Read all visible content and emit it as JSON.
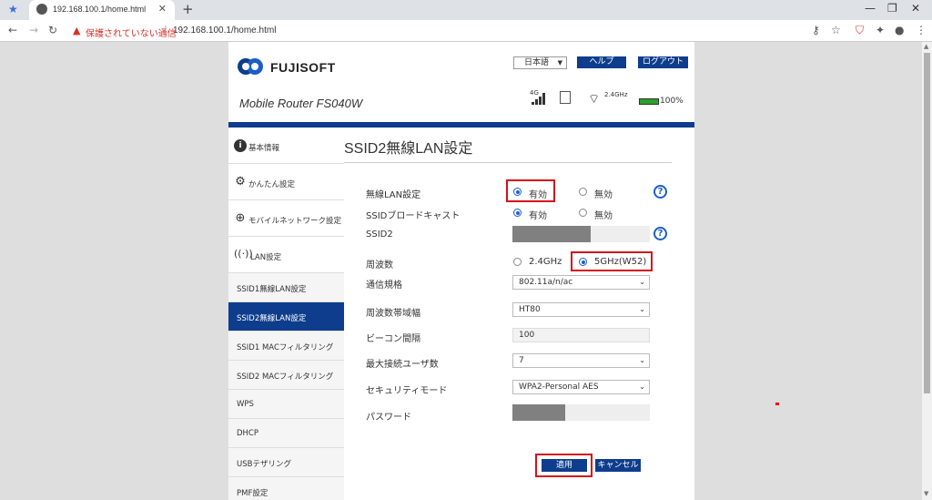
{
  "browser": {
    "tab_title": "192.168.100.1/home.html",
    "warning_text": "保護されていない通信",
    "url": "192.168.100.1/home.html"
  },
  "header": {
    "brand": "FUJISOFT",
    "language": "日本語",
    "help_label": "ヘルプ",
    "logout_label": "ログアウト",
    "model_name": "Mobile Router FS040W",
    "network_label": "4G",
    "wifi_band": "2.4GHz",
    "battery": "100%",
    "accent_color": "#0d3d8c"
  },
  "sidebar": {
    "items": [
      {
        "label": "基本情報",
        "icon": "info-icon"
      },
      {
        "label": "かんたん設定",
        "icon": "gear-icon"
      },
      {
        "label": "モバイルネットワーク設定",
        "icon": "globe-icon"
      },
      {
        "label": "LAN設定",
        "icon": "antenna-icon"
      }
    ],
    "sub_items": [
      {
        "label": "SSID1無線LAN設定"
      },
      {
        "label": "SSID2無線LAN設定",
        "active": true
      },
      {
        "label": "SSID1 MACフィルタリング"
      },
      {
        "label": "SSID2 MACフィルタリング"
      },
      {
        "label": "WPS"
      },
      {
        "label": "DHCP"
      },
      {
        "label": "USBテザリング"
      },
      {
        "label": "PMF設定"
      }
    ]
  },
  "main": {
    "title": "SSID2無線LAN設定",
    "wireless_lan": {
      "label": "無線LAN設定",
      "on": "有効",
      "off": "無効",
      "value": "on"
    },
    "ssid_broadcast": {
      "label": "SSIDブロードキャスト",
      "on": "有効",
      "off": "無効",
      "value": "on"
    },
    "ssid2": {
      "label": "SSID2"
    },
    "frequency": {
      "label": "周波数",
      "opt1": "2.4GHz",
      "opt2": "5GHz(W52)",
      "value": "5GHz(W52)"
    },
    "standard": {
      "label": "通信規格",
      "value": "802.11a/n/ac"
    },
    "bandwidth": {
      "label": "周波数帯域幅",
      "value": "HT80"
    },
    "beacon": {
      "label": "ビーコン間隔",
      "value": "100"
    },
    "max_users": {
      "label": "最大接続ユーザ数",
      "value": "7"
    },
    "security": {
      "label": "セキュリティモード",
      "value": "WPA2-Personal AES"
    },
    "password": {
      "label": "パスワード"
    },
    "apply_label": "適用",
    "cancel_label": "キャンセル"
  }
}
